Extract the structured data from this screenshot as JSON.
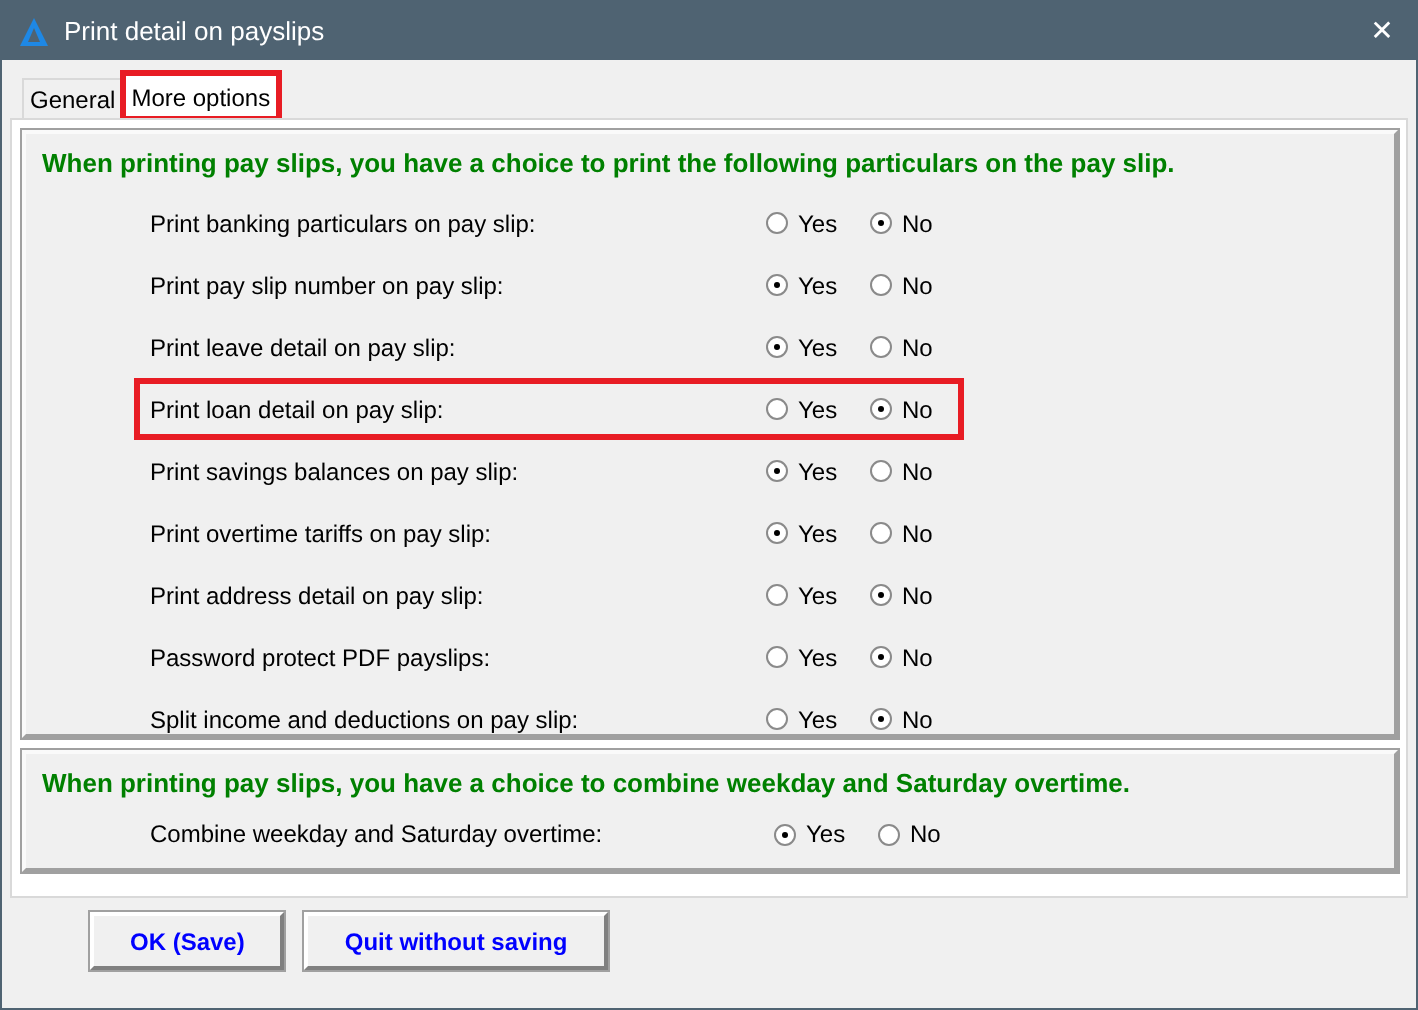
{
  "window": {
    "title": "Print detail on payslips",
    "close": "✕"
  },
  "tabs": [
    {
      "label": "General",
      "selected": false,
      "highlighted": false
    },
    {
      "label": "More options",
      "selected": true,
      "highlighted": true
    }
  ],
  "sections": [
    {
      "heading": "When printing pay slips, you have a choice to print the following particulars on the pay slip.",
      "rows": [
        {
          "label": "Print banking particulars on pay slip:",
          "options": [
            {
              "label": "Yes",
              "selected": false
            },
            {
              "label": "No",
              "selected": true
            }
          ],
          "highlighted": false
        },
        {
          "label": "Print pay slip number on pay slip:",
          "options": [
            {
              "label": "Yes",
              "selected": true
            },
            {
              "label": "No",
              "selected": false
            }
          ],
          "highlighted": false
        },
        {
          "label": "Print leave detail on pay slip:",
          "options": [
            {
              "label": "Yes",
              "selected": true
            },
            {
              "label": "No",
              "selected": false
            }
          ],
          "highlighted": false
        },
        {
          "label": "Print loan detail on pay slip:",
          "options": [
            {
              "label": "Yes",
              "selected": false
            },
            {
              "label": "No",
              "selected": true
            }
          ],
          "highlighted": true
        },
        {
          "label": "Print savings balances on pay slip:",
          "options": [
            {
              "label": "Yes",
              "selected": true
            },
            {
              "label": "No",
              "selected": false
            }
          ],
          "highlighted": false
        },
        {
          "label": "Print overtime tariffs on pay slip:",
          "options": [
            {
              "label": "Yes",
              "selected": true
            },
            {
              "label": "No",
              "selected": false
            }
          ],
          "highlighted": false
        },
        {
          "label": "Print address detail on pay slip:",
          "options": [
            {
              "label": "Yes",
              "selected": false
            },
            {
              "label": "No",
              "selected": true
            }
          ],
          "highlighted": false
        },
        {
          "label": "Password protect PDF payslips:",
          "options": [
            {
              "label": "Yes",
              "selected": false
            },
            {
              "label": "No",
              "selected": true
            }
          ],
          "highlighted": false
        },
        {
          "label": "Split income and deductions on pay slip:",
          "options": [
            {
              "label": "Yes",
              "selected": false
            },
            {
              "label": "No",
              "selected": true
            }
          ],
          "highlighted": false
        }
      ]
    },
    {
      "heading": "When printing pay slips, you have a choice to combine weekday and Saturday overtime.",
      "rows": [
        {
          "label": "Combine weekday and Saturday overtime:",
          "options": [
            {
              "label": "Yes",
              "selected": true
            },
            {
              "label": "No",
              "selected": false
            }
          ],
          "highlighted": false
        }
      ]
    }
  ],
  "buttons": [
    "OK (Save)",
    "Quit without saving"
  ]
}
